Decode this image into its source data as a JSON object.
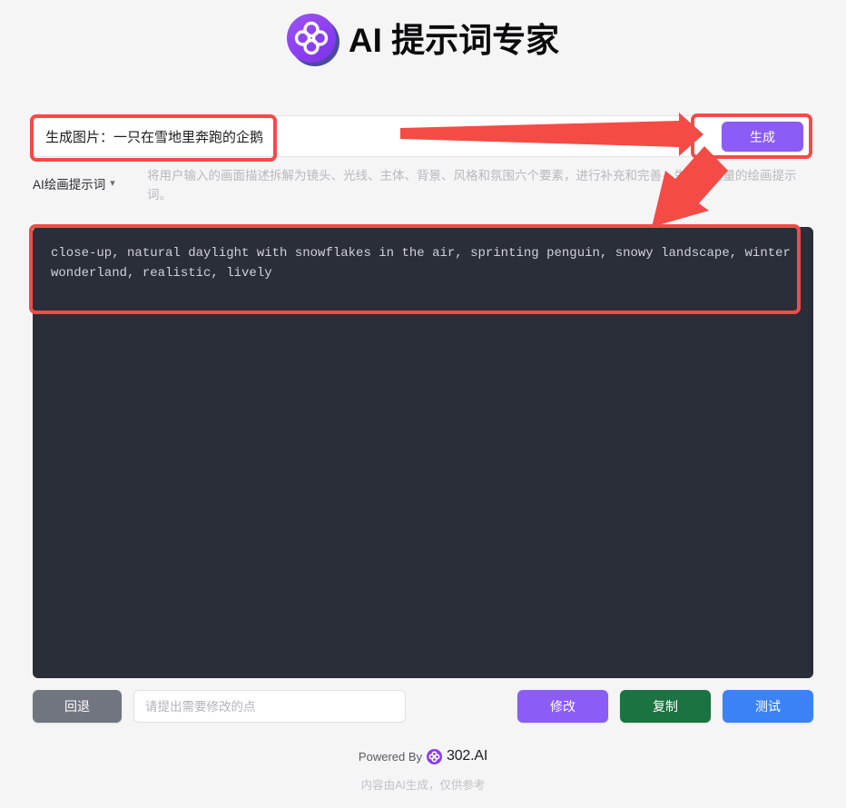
{
  "header": {
    "title": "AI 提示词专家",
    "logo_icon": "four-leaf-clover-icon",
    "brand_color": "#8b3df0"
  },
  "input_row": {
    "value": "生成图片：一只在雪地里奔跑的企鹅",
    "placeholder": "",
    "generate_label": "生成",
    "generate_color": "#8b5cf6"
  },
  "meta": {
    "model_label": "AI绘画提示词",
    "chevron_icon": "chevron-down-icon",
    "description": "将用户输入的画面描述拆解为镜头、光线、主体、背景、风格和氛围六个要素，进行补充和完善，生成高质量的绘画提示词。"
  },
  "output": {
    "text": "close-up, natural daylight with snowflakes in the air, sprinting penguin, snowy landscape, winter wonderland, realistic, lively",
    "panel_color": "#2a2e39"
  },
  "bottom_bar": {
    "back_label": "回退",
    "revise_placeholder": "请提出需要修改的点",
    "revise_value": "",
    "modify_label": "修改",
    "copy_label": "复制",
    "test_label": "测试",
    "back_color": "#71757f",
    "modify_color": "#8b5cf6",
    "copy_color": "#1a7340",
    "test_color": "#3b82f6"
  },
  "footer": {
    "powered_by": "Powered By",
    "brand": "302.AI",
    "disclaimer": "内容由AI生成，仅供参考"
  },
  "annotations": {
    "highlight_color": "#f44b46",
    "boxes": [
      "input-field",
      "generate-button",
      "output-panel"
    ],
    "arrows": [
      "arrow-to-generate-button",
      "arrow-to-output-panel"
    ]
  }
}
